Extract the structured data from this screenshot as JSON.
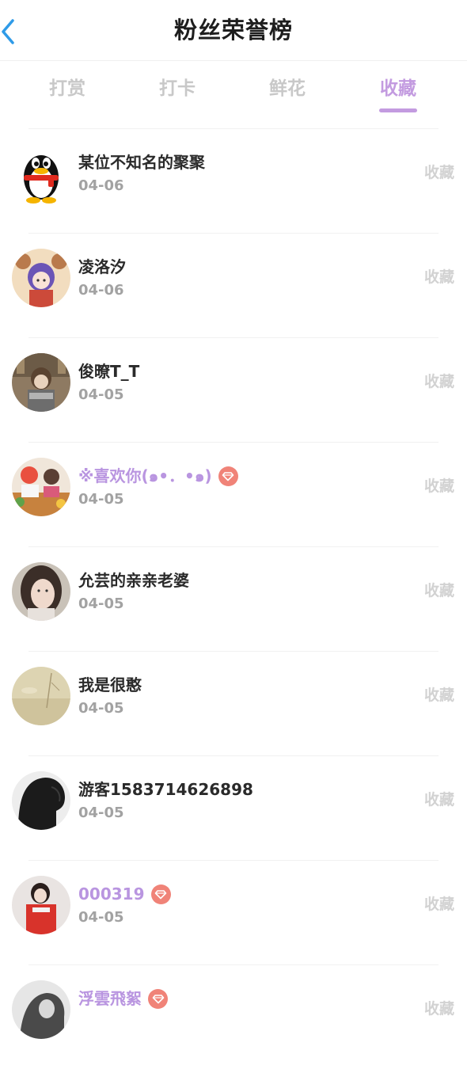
{
  "header": {
    "title": "粉丝荣誉榜",
    "back_icon": "chevron-left-icon"
  },
  "tabs": [
    {
      "label": "打赏",
      "active": false
    },
    {
      "label": "打卡",
      "active": false
    },
    {
      "label": "鲜花",
      "active": false
    },
    {
      "label": "收藏",
      "active": true
    }
  ],
  "colors": {
    "accent": "#c39be0",
    "vip_name": "#b995e0",
    "vip_badge": "#f08378",
    "back_arrow": "#2f9be8",
    "inactive_tab": "#c8c8c8",
    "date_text": "#a2a2a2",
    "action_text": "#d2d2d2"
  },
  "list": [
    {
      "name": "某位不知名的聚聚",
      "date": "04-06",
      "action": "收藏",
      "vip": false
    },
    {
      "name": "凌洛汐",
      "date": "04-06",
      "action": "收藏",
      "vip": false
    },
    {
      "name": "俊暸T_T",
      "date": "04-05",
      "action": "收藏",
      "vip": false
    },
    {
      "name": "※喜欢你(๑•．•๑)",
      "date": "04-05",
      "action": "收藏",
      "vip": true
    },
    {
      "name": "允芸的亲亲老婆",
      "date": "04-05",
      "action": "收藏",
      "vip": false
    },
    {
      "name": "我是很憨",
      "date": "04-05",
      "action": "收藏",
      "vip": false
    },
    {
      "name": "游客1583714626898",
      "date": "04-05",
      "action": "收藏",
      "vip": false
    },
    {
      "name": "000319",
      "date": "04-05",
      "action": "收藏",
      "vip": true
    },
    {
      "name": "浮雲飛絮",
      "date": "",
      "action": "收藏",
      "vip": true
    }
  ]
}
